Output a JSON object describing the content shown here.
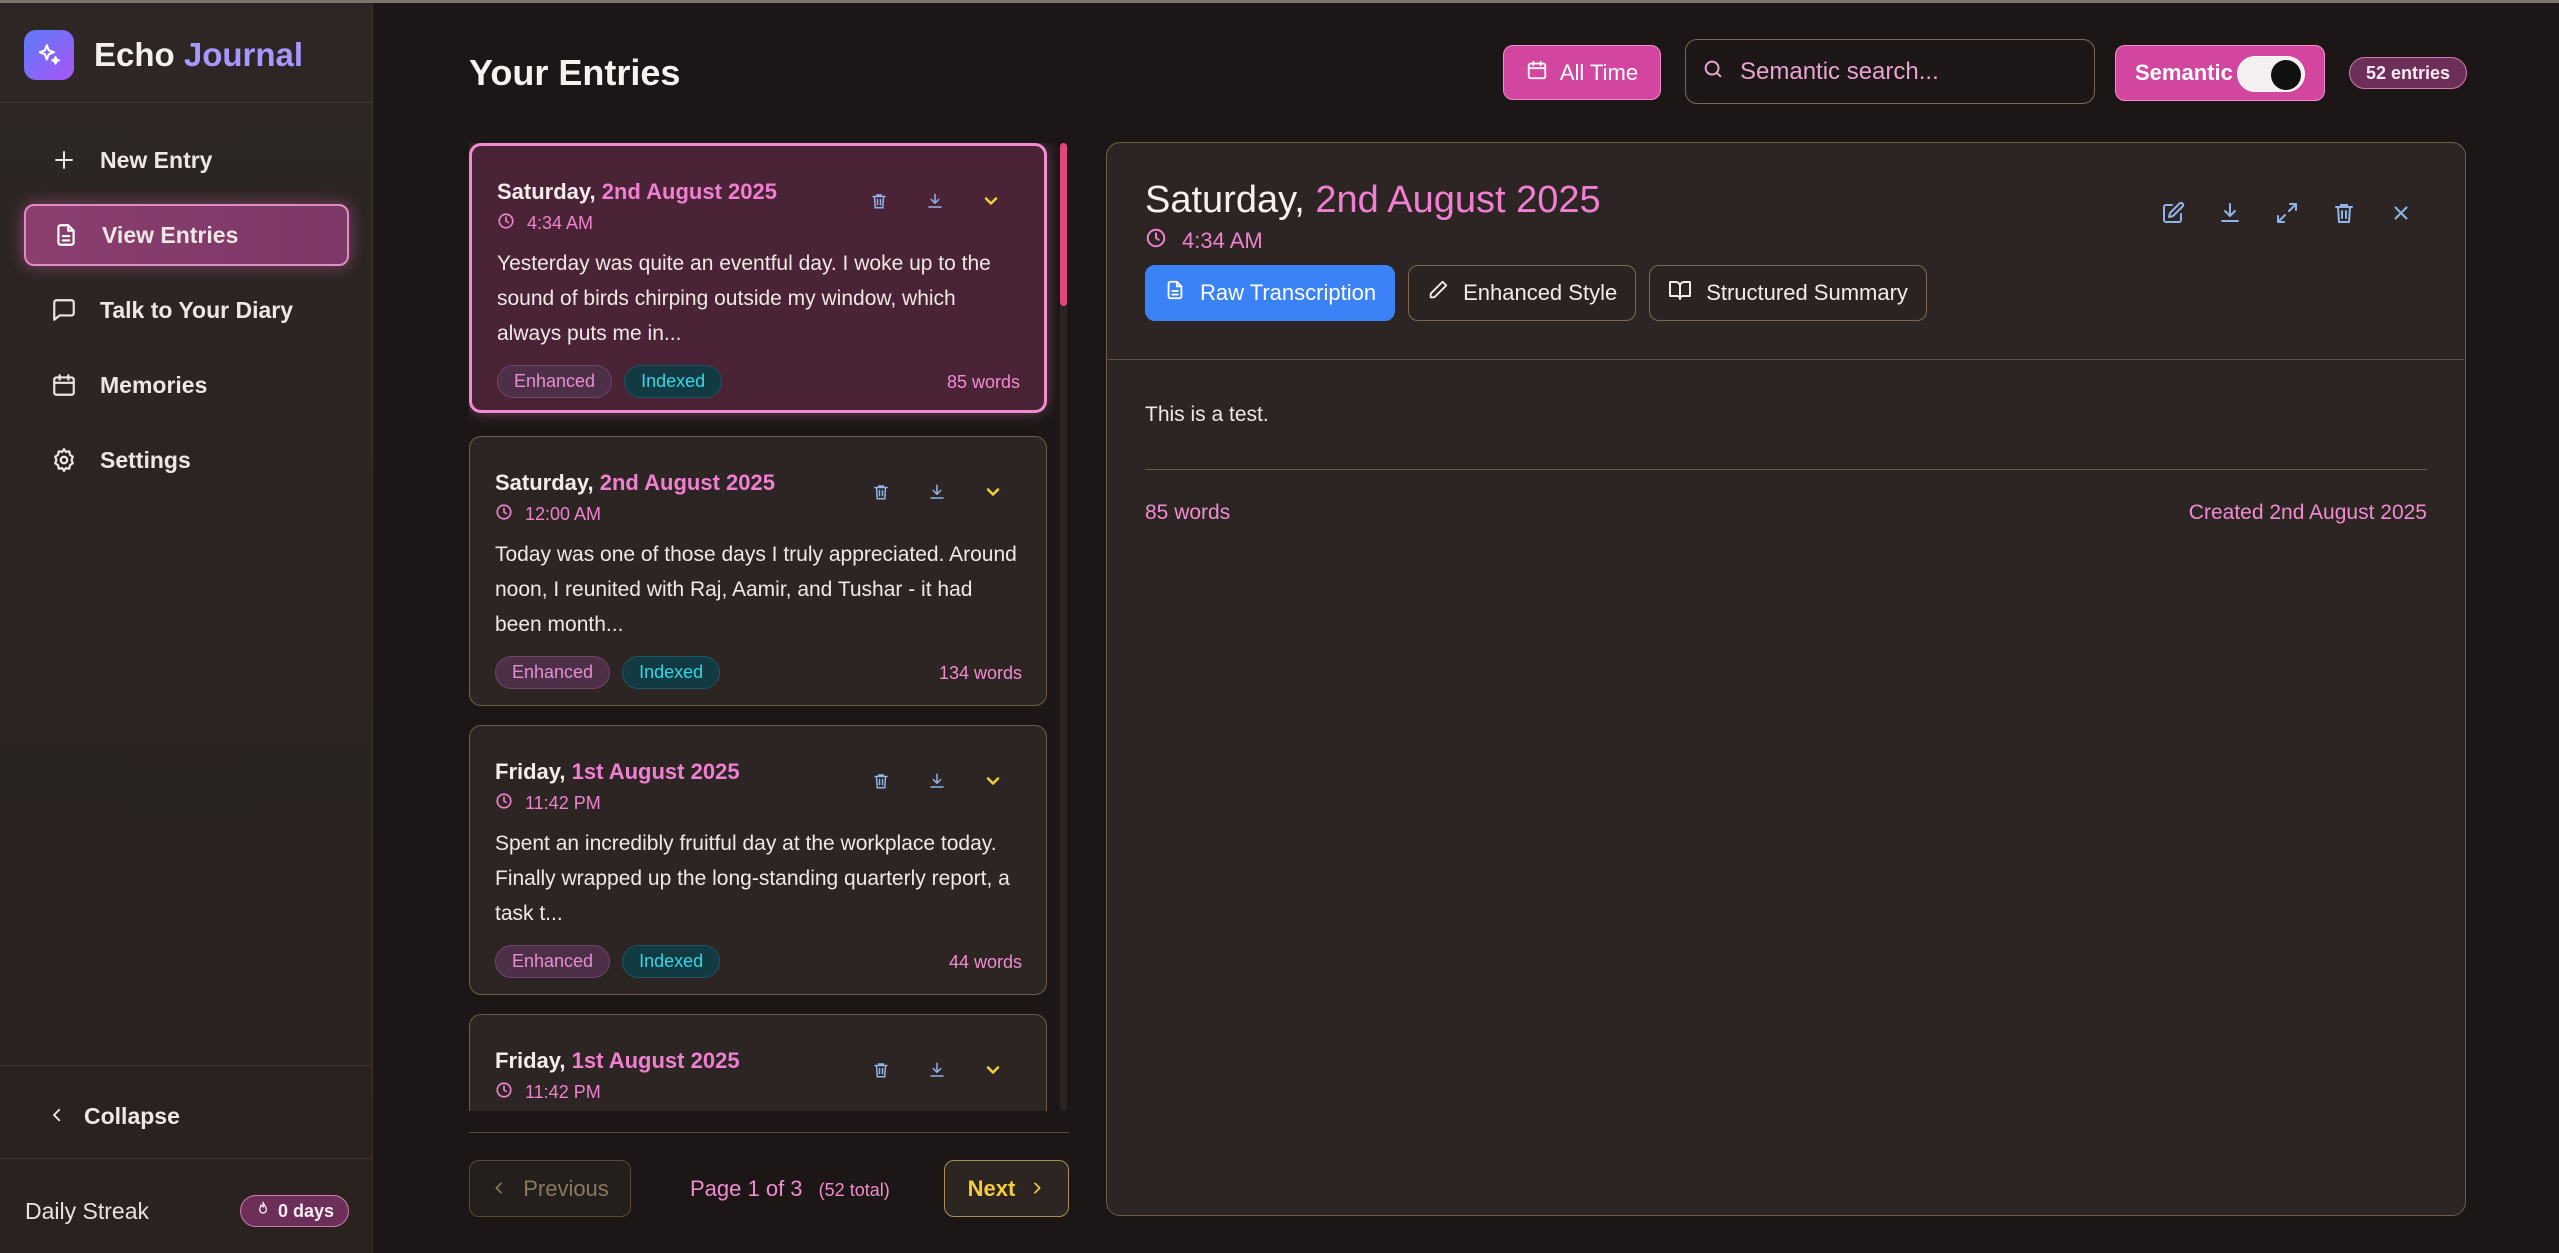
{
  "app": {
    "name_part1": "Echo",
    "name_part2": "Journal"
  },
  "sidebar": {
    "nav": [
      {
        "label": "New Entry",
        "icon": "plus-icon"
      },
      {
        "label": "View Entries",
        "icon": "document-icon",
        "active": true
      },
      {
        "label": "Talk to Your Diary",
        "icon": "chat-icon"
      },
      {
        "label": "Memories",
        "icon": "calendar-icon"
      },
      {
        "label": "Settings",
        "icon": "gear-icon"
      }
    ],
    "collapse_label": "Collapse",
    "streak_label": "Daily Streak",
    "streak_value": "0 days"
  },
  "header": {
    "title": "Your Entries",
    "filter_label": "All Time",
    "search_placeholder": "Semantic search...",
    "semantic_label": "Semantic",
    "semantic_on": true,
    "entries_count": "52 entries"
  },
  "entries": [
    {
      "weekday": "Saturday,",
      "date": "2nd August 2025",
      "time": "4:34 AM",
      "excerpt": "Yesterday was quite an eventful day. I woke up to the sound of birds chirping outside my window, which always puts me in...",
      "tags": [
        "Enhanced",
        "Indexed"
      ],
      "words": "85 words",
      "selected": true
    },
    {
      "weekday": "Saturday,",
      "date": "2nd August 2025",
      "time": "12:00 AM",
      "excerpt": "Today was one of those days I truly appreciated. Around noon, I reunited with Raj, Aamir, and Tushar - it had been month...",
      "tags": [
        "Enhanced",
        "Indexed"
      ],
      "words": "134 words"
    },
    {
      "weekday": "Friday,",
      "date": "1st August 2025",
      "time": "11:42 PM",
      "excerpt": "Spent an incredibly fruitful day at the workplace today. Finally wrapped up the long-standing quarterly report, a task t...",
      "tags": [
        "Enhanced",
        "Indexed"
      ],
      "words": "44 words"
    },
    {
      "weekday": "Friday,",
      "date": "1st August 2025",
      "time": "11:42 PM",
      "excerpt": "",
      "tags": [],
      "words": ""
    }
  ],
  "pagination": {
    "prev_label": "Previous",
    "page_text": "Page 1 of 3",
    "total_text": "(52 total)",
    "next_label": "Next"
  },
  "detail": {
    "weekday": "Saturday,",
    "date": "2nd August 2025",
    "time": "4:34 AM",
    "tabs": [
      {
        "label": "Raw Transcription",
        "icon": "document-icon",
        "active": true
      },
      {
        "label": "Enhanced Style",
        "icon": "pencil-icon"
      },
      {
        "label": "Structured Summary",
        "icon": "book-icon"
      }
    ],
    "content": "This is a test.",
    "words": "85 words",
    "created": "Created 2nd August 2025"
  },
  "colors": {
    "accent_pink": "#f07fd1",
    "button_pink": "#d346a0",
    "active_tab_blue": "#3b82f6",
    "indexed_cyan": "#36d6e6",
    "next_yellow": "#f3cd3c",
    "scroll_thumb": "#e4457a"
  }
}
